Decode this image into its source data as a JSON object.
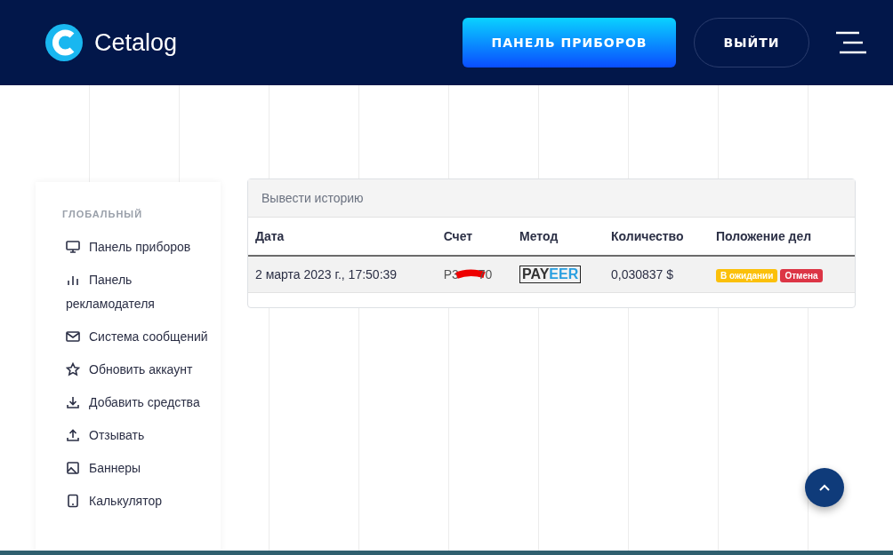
{
  "header": {
    "brand": "Cetalog",
    "dashboard_button": "ПАНЕЛЬ ПРИБОРОВ",
    "logout_button": "ВЫЙТИ"
  },
  "sidebar": {
    "section_title": "ГЛОБАЛЬНЫЙ",
    "items": [
      {
        "kind": "monitor",
        "label": "Панель приборов"
      },
      {
        "kind": "chart",
        "label": "Панель рекламодателя"
      },
      {
        "kind": "mail",
        "label": "Система сообщений"
      },
      {
        "kind": "star",
        "label": "Обновить аккаунт"
      },
      {
        "kind": "download",
        "label": "Добавить средства"
      },
      {
        "kind": "upload",
        "label": "Отзывать"
      },
      {
        "kind": "image",
        "label": "Баннеры"
      },
      {
        "kind": "tablet",
        "label": "Калькулятор"
      }
    ]
  },
  "history": {
    "title": "Вывести историю",
    "columns": [
      "Дата",
      "Счет",
      "Метод",
      "Количество",
      "Положение дел"
    ],
    "rows": [
      {
        "date": "2 марта 2023 г., 17:50:39",
        "account_start": "P3",
        "account_end": "70",
        "method_logo": [
          "PAY",
          "EER"
        ],
        "amount": "0,030837 $",
        "badges": [
          {
            "kind": "pending",
            "label": "В ожидании"
          },
          {
            "kind": "cancel",
            "label": "Отмена"
          }
        ]
      }
    ]
  }
}
